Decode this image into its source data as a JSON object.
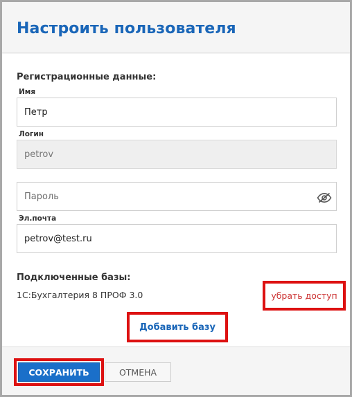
{
  "dialog": {
    "title": "Настроить пользователя"
  },
  "registration": {
    "section_label": "Регистрационные данные:",
    "name_label": "Имя",
    "name_value": "Петр",
    "login_label": "Логин",
    "login_value": "petrov",
    "password_placeholder": "Пароль",
    "email_label": "Эл.почта",
    "email_value": "petrov@test.ru"
  },
  "databases": {
    "section_label": "Подключенные базы:",
    "items": [
      {
        "name": "1С:Бухгалтерия 8 ПРОФ 3.0",
        "remove_label": "убрать доступ"
      }
    ],
    "add_label": "Добавить базу"
  },
  "footer": {
    "save_label": "СОХРАНИТЬ",
    "cancel_label": "ОТМЕНА"
  },
  "icons": {
    "password_toggle": "eye-slash-icon"
  },
  "colors": {
    "accent": "#1a66b8",
    "danger": "#cc3333",
    "highlight": "#dd1111"
  }
}
